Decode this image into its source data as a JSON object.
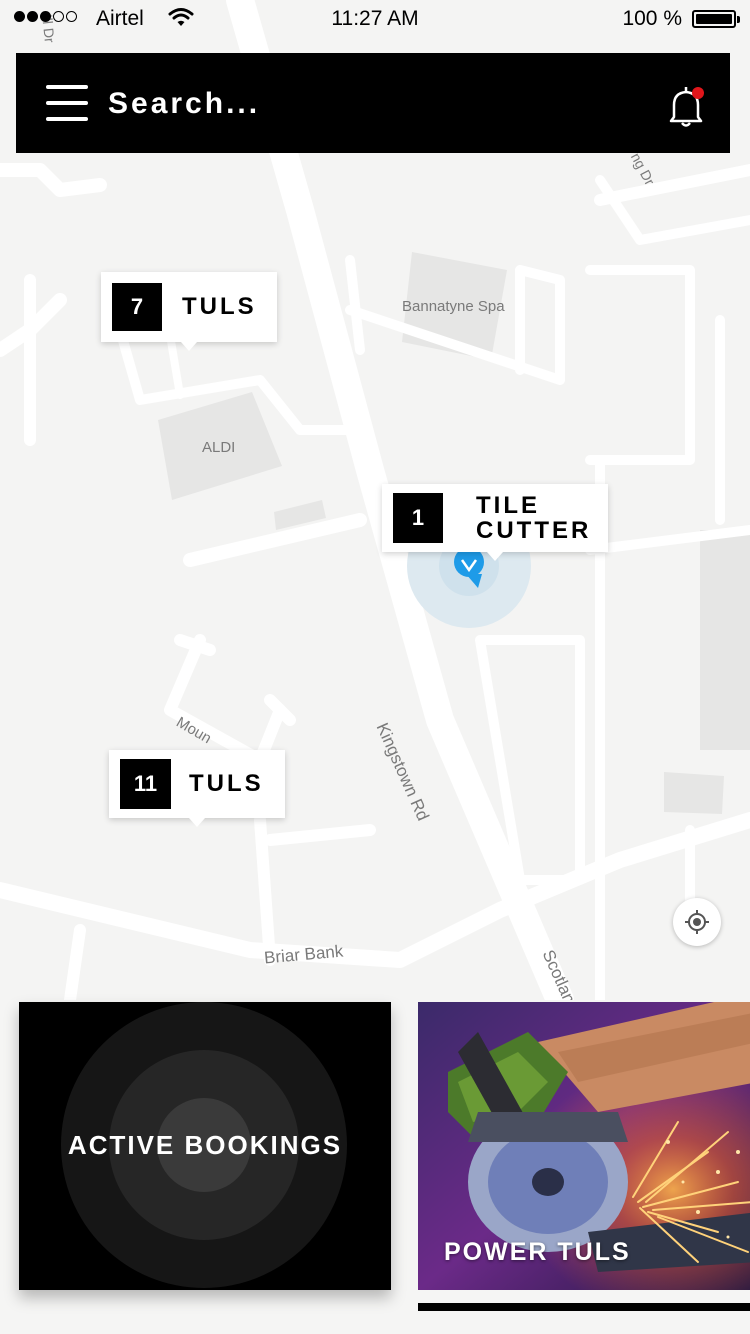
{
  "status_bar": {
    "carrier": "Airtel",
    "time": "11:27 AM",
    "battery": "100 %",
    "signal_filled": 3,
    "signal_total": 5
  },
  "search": {
    "placeholder": "Search...",
    "notification_dot_color": "#e0161b"
  },
  "map": {
    "labels": {
      "spa": "Bannatyne Spa",
      "aldi": "ALDI",
      "kingstown": "Kingstown Rd",
      "briar": "Briar Bank",
      "scotland": "Scotlan",
      "mount": "Moun",
      "top_left_fragment": "ill Dr",
      "top_right_fragment": "ng Dr"
    },
    "markers": [
      {
        "count": "7",
        "label": "TULS"
      },
      {
        "count": "1",
        "label_line1": "TILE",
        "label_line2": "CUTTER"
      },
      {
        "count": "11",
        "label": "TULS"
      }
    ],
    "location_color": "#1e9be8"
  },
  "cards": {
    "active_bookings": "ACTIVE BOOKINGS",
    "power_tools": "POWER TULS"
  }
}
